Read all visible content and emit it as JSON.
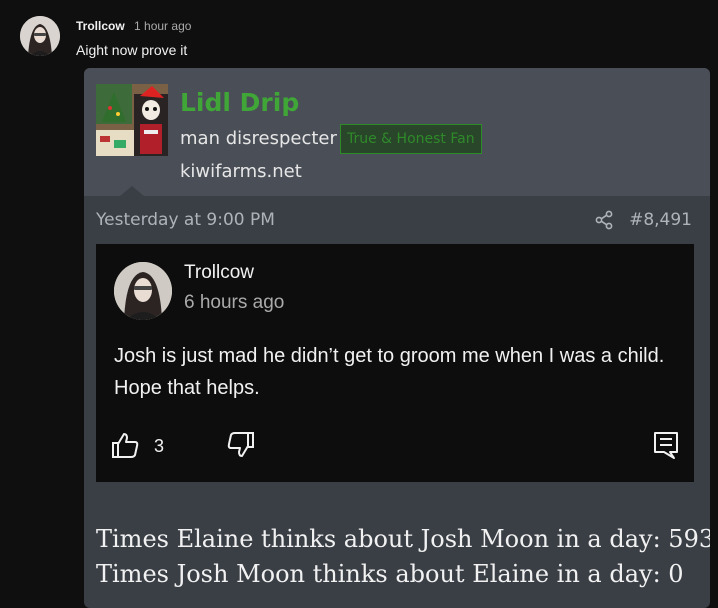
{
  "comment": {
    "author": "Trollcow",
    "time": "1 hour ago",
    "text": "Aight now prove it"
  },
  "embedded_card": {
    "poster_name": "Lidl Drip",
    "poster_title": "man disrespecter",
    "badge": "True & Honest Fan",
    "site": "kiwifarms.net",
    "post_date": "Yesterday at 9:00 PM",
    "post_number": "#8,491",
    "quoted_comment": {
      "author": "Trollcow",
      "time": "6 hours ago",
      "text": "Josh is just mad he didn’t get to groom me when I was a child. Hope that helps.",
      "like_count": "3"
    },
    "lines": [
      "Times Elaine thinks about Josh Moon in a day: 593",
      "Times Josh Moon thinks about Elaine in a day: 0"
    ]
  },
  "colors": {
    "background": "#0f0f0f",
    "card": "#3a3f46",
    "poster_name": "#3fa637",
    "badge_border": "#2f8a2a"
  },
  "icons": [
    "share-icon",
    "thumbs-up-icon",
    "thumbs-down-icon",
    "reply-icon"
  ]
}
